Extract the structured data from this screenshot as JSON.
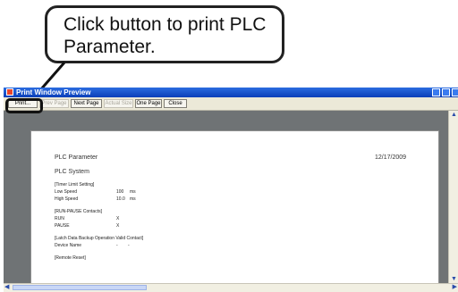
{
  "callout": {
    "line1": "Click button to print PLC",
    "line2": "Parameter."
  },
  "window": {
    "title": "Print Window Preview"
  },
  "toolbar": {
    "print": "Print...",
    "prev_page": "Prev Page",
    "next_page": "Next Page",
    "actual_size": "Actual Size",
    "one_page": "One Page",
    "close": "Close"
  },
  "page": {
    "title": "PLC Parameter",
    "date": "12/17/2009",
    "subtitle": "PLC System",
    "timer_section": "[Timer Limit Setting]",
    "low_speed_label": "Low Speed",
    "low_speed_value": "100",
    "low_speed_unit": "ms",
    "high_speed_label": "High Speed",
    "high_speed_value": "10.0",
    "high_speed_unit": "ms",
    "run_pause_section": "[RUN-PAUSE Contacts]",
    "run_label": "RUN",
    "run_value": "X",
    "pause_label": "PAUSE",
    "pause_value": "X",
    "latch_section": "[Latch Data Backup Operation Valid Contact]",
    "device_name_label": "Device Name",
    "device_name_value": "-",
    "device_name_value2": "-",
    "remote_reset_section": "[Remote Reset]"
  },
  "icons": {
    "scroll_up": "up-arrow",
    "scroll_down": "down-arrow",
    "scroll_left": "left-arrow",
    "scroll_right": "right-arrow"
  }
}
